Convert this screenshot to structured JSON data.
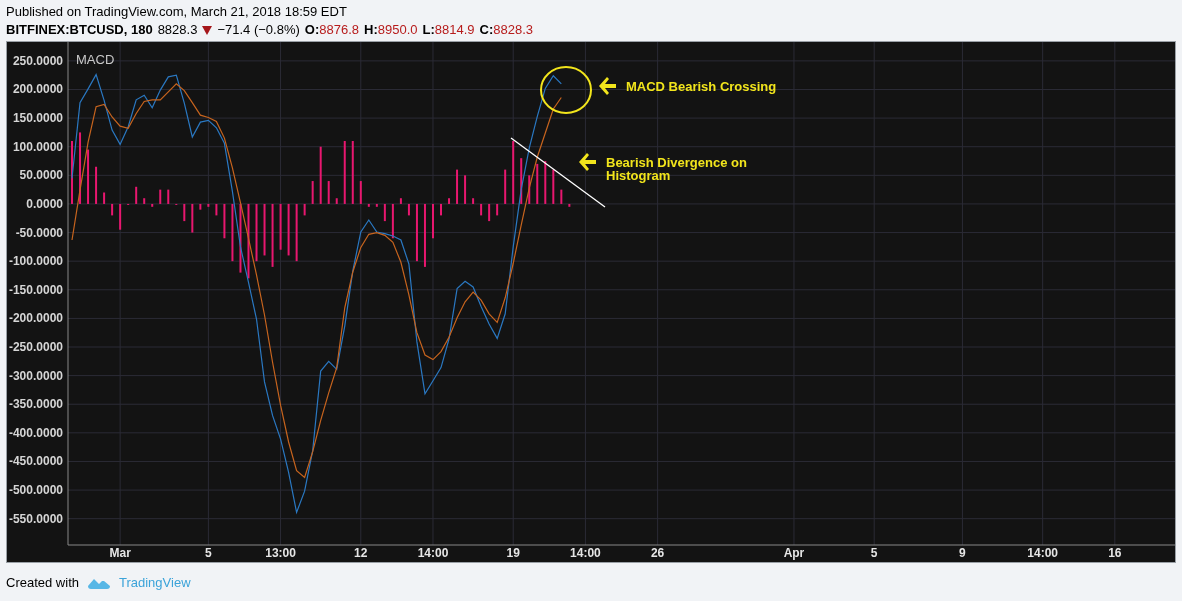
{
  "header": {
    "published": "Published on TradingView.com, March 21, 2018 18:59 EDT",
    "symbol": "BITFINEX:BTCUSD, 180",
    "last": "8828.3",
    "change": "−71.4 (−0.8%)",
    "ohlc": [
      {
        "label": "O:",
        "value": "8876.8"
      },
      {
        "label": "H:",
        "value": "8950.0"
      },
      {
        "label": "L:",
        "value": "8814.9"
      },
      {
        "label": "C:",
        "value": "8828.3"
      }
    ]
  },
  "chart": {
    "legend": "MACD",
    "callouts": [
      "MACD Bearish Crossing",
      "Bearish Divergence on Histogram"
    ],
    "chart_data": {
      "type": "line",
      "grid": true,
      "ylim": [
        -596,
        283
      ],
      "categories": [
        null,
        null,
        null,
        null,
        null,
        null,
        "Mar",
        null,
        null,
        null,
        null,
        null,
        null,
        null,
        null,
        null,
        null,
        "5",
        null,
        null,
        null,
        null,
        null,
        null,
        null,
        null,
        "13:00",
        null,
        null,
        null,
        null,
        null,
        null,
        null,
        null,
        null,
        "12",
        null,
        null,
        null,
        null,
        null,
        null,
        null,
        null,
        "14:00",
        null,
        null,
        null,
        null,
        null,
        null,
        null,
        null,
        null,
        "19",
        null,
        null,
        null,
        null,
        null,
        null,
        null,
        null,
        "14:00",
        null,
        null,
        null,
        null,
        null,
        null,
        null,
        null,
        "26",
        null,
        null,
        null,
        null,
        null,
        null,
        null,
        null,
        null,
        null,
        null,
        null,
        null,
        null,
        null,
        null,
        "Apr",
        null,
        null,
        null,
        null,
        null,
        null,
        null,
        null,
        null,
        "5",
        null,
        null,
        null,
        null,
        null,
        null,
        null,
        null,
        null,
        null,
        "9",
        null,
        null,
        null,
        null,
        null,
        null,
        null,
        null,
        null,
        "14:00",
        null,
        null,
        null,
        null,
        null,
        null,
        null,
        null,
        "16",
        null,
        null,
        null,
        null,
        null,
        null,
        null
      ],
      "yticks": [
        {
          "value": 250,
          "label": "250.0000"
        },
        {
          "value": 200,
          "label": "200.0000"
        },
        {
          "value": 150,
          "label": "150.0000"
        },
        {
          "value": 100,
          "label": "100.0000"
        },
        {
          "value": 50,
          "label": "50.0000"
        },
        {
          "value": 0,
          "label": "0.0000"
        },
        {
          "value": -50,
          "label": "-50.0000"
        },
        {
          "value": -100,
          "label": "-100.0000"
        },
        {
          "value": -150,
          "label": "-150.0000"
        },
        {
          "value": -200,
          "label": "-200.0000"
        },
        {
          "value": -250,
          "label": "-250.0000"
        },
        {
          "value": -300,
          "label": "-300.0000"
        },
        {
          "value": -350,
          "label": "-350.0000"
        },
        {
          "value": -400,
          "label": "-400.0000"
        },
        {
          "value": -450,
          "label": "-450.0000"
        },
        {
          "value": -500,
          "label": "-500.0000"
        },
        {
          "value": -550,
          "label": "-550.0000"
        }
      ],
      "series": [
        {
          "type": "bar",
          "color": "#e8176f",
          "values": [
            110,
            125,
            95,
            65,
            20,
            -20,
            -45,
            0,
            30,
            10,
            -5,
            25,
            25,
            0,
            -30,
            -50,
            -10,
            -5,
            -20,
            -60,
            -100,
            -120,
            -130,
            -100,
            -90,
            -110,
            -80,
            -90,
            -100,
            -20,
            40,
            100,
            40,
            10,
            110,
            110,
            40,
            -5,
            -5,
            -30,
            -60,
            10,
            -20,
            -100,
            -110,
            -60,
            -20,
            10,
            60,
            50,
            10,
            -20,
            -30,
            -20,
            60,
            110,
            80,
            50,
            70,
            75,
            60,
            25,
            -5,
            null,
            null,
            null,
            null,
            null,
            null,
            null,
            null,
            null,
            null,
            null,
            null,
            null,
            null,
            null,
            null,
            null,
            null,
            null,
            null,
            null,
            null,
            null,
            null,
            null,
            null,
            null,
            null,
            null,
            null,
            null,
            null,
            null,
            null,
            null,
            null,
            null,
            null,
            null,
            null,
            null,
            null,
            null,
            null,
            null,
            null,
            null,
            null,
            null,
            null,
            null,
            null,
            null,
            null,
            null,
            null,
            null,
            null,
            null,
            null,
            null,
            null,
            null,
            null,
            null,
            null,
            null,
            null,
            null,
            null,
            null,
            null,
            null,
            null,
            null
          ]
        },
        {
          "type": "line",
          "color": "#2a78c2",
          "values": [
            45,
            177,
            201,
            226,
            181,
            129,
            104,
            135,
            182,
            190,
            168,
            199,
            222,
            225,
            176,
            117,
            143,
            146,
            133,
            106,
            22,
            -75,
            -137,
            -201,
            -311,
            -370,
            -411,
            -469,
            -539,
            -502,
            -431,
            -292,
            -275,
            -289,
            -213,
            -117,
            -49,
            -28,
            -49,
            -52,
            -56,
            -63,
            -105,
            -241,
            -332,
            -309,
            -286,
            -236,
            -148,
            -135,
            -145,
            -179,
            -210,
            -235,
            -192,
            -75,
            25,
            98,
            153,
            202,
            224,
            210,
            null,
            null,
            null,
            null,
            null,
            null,
            null,
            null,
            null,
            null,
            null,
            null,
            null,
            null,
            null,
            null,
            null,
            null,
            null,
            null,
            null,
            null,
            null,
            null,
            null,
            null,
            null,
            null,
            null,
            null,
            null,
            null,
            null,
            null,
            null,
            null,
            null,
            null,
            null,
            null,
            null,
            null,
            null,
            null,
            null,
            null,
            null,
            null,
            null,
            null,
            null,
            null,
            null,
            null,
            null,
            null,
            null,
            null,
            null,
            null,
            null,
            null,
            null,
            null,
            null,
            null,
            null,
            null,
            null,
            null,
            null,
            null,
            null,
            null,
            null,
            null
          ]
        },
        {
          "type": "line",
          "color": "#c7641e",
          "values": [
            -63,
            24,
            108,
            170,
            174,
            152,
            136,
            132,
            158,
            179,
            182,
            182,
            196,
            210,
            198,
            177,
            155,
            151,
            144,
            115,
            63,
            2,
            -60,
            -124,
            -194,
            -277,
            -352,
            -416,
            -466,
            -478,
            -433,
            -378,
            -330,
            -286,
            -181,
            -119,
            -76,
            -53,
            -50,
            -55,
            -67,
            -102,
            -159,
            -225,
            -264,
            -272,
            -258,
            -233,
            -199,
            -171,
            -154,
            -168,
            -192,
            -207,
            -164,
            -104,
            -37,
            28,
            82,
            124,
            166,
            186,
            null,
            null,
            null,
            null,
            null,
            null,
            null,
            null,
            null,
            null,
            null,
            null,
            null,
            null,
            null,
            null,
            null,
            null,
            null,
            null,
            null,
            null,
            null,
            null,
            null,
            null,
            null,
            null,
            null,
            null,
            null,
            null,
            null,
            null,
            null,
            null,
            null,
            null,
            null,
            null,
            null,
            null,
            null,
            null,
            null,
            null,
            null,
            null,
            null,
            null,
            null,
            null,
            null,
            null,
            null,
            null,
            null,
            null,
            null,
            null,
            null,
            null,
            null,
            null,
            null,
            null,
            null,
            null,
            null,
            null,
            null,
            null,
            null,
            null,
            null,
            null
          ]
        }
      ]
    }
  },
  "footer": {
    "text": "Created with",
    "link": "TradingView"
  }
}
